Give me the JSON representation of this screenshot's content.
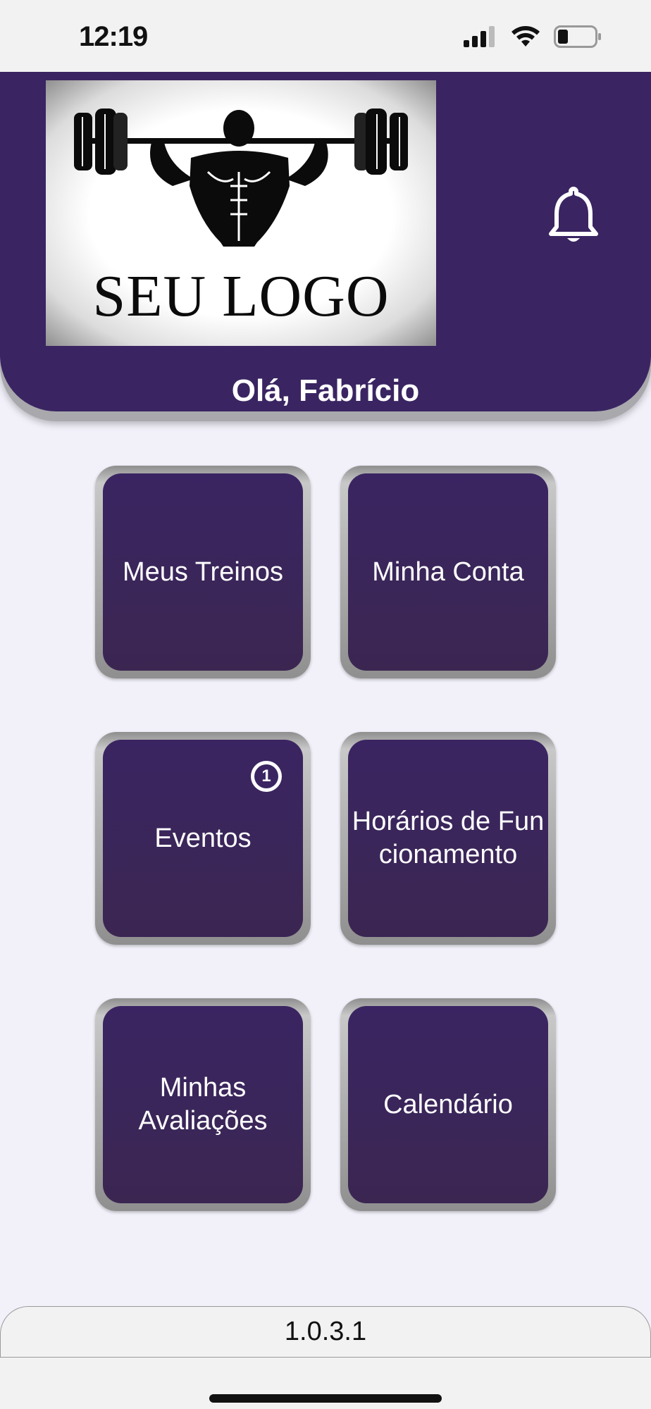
{
  "status_bar": {
    "time": "12:19"
  },
  "header": {
    "logo_text": "SEU LOGO",
    "greeting": "Olá, Fabrício",
    "color": "#3a2562"
  },
  "menu": {
    "tiles": [
      {
        "label": "Meus Treinos"
      },
      {
        "label": "Minha Conta"
      },
      {
        "label": "Eventos",
        "badge": "1"
      },
      {
        "label": "Horários de Funcionamento"
      },
      {
        "label": "Minhas Avaliações"
      },
      {
        "label": "Calendário"
      }
    ]
  },
  "footer": {
    "version": "1.0.3.1"
  }
}
